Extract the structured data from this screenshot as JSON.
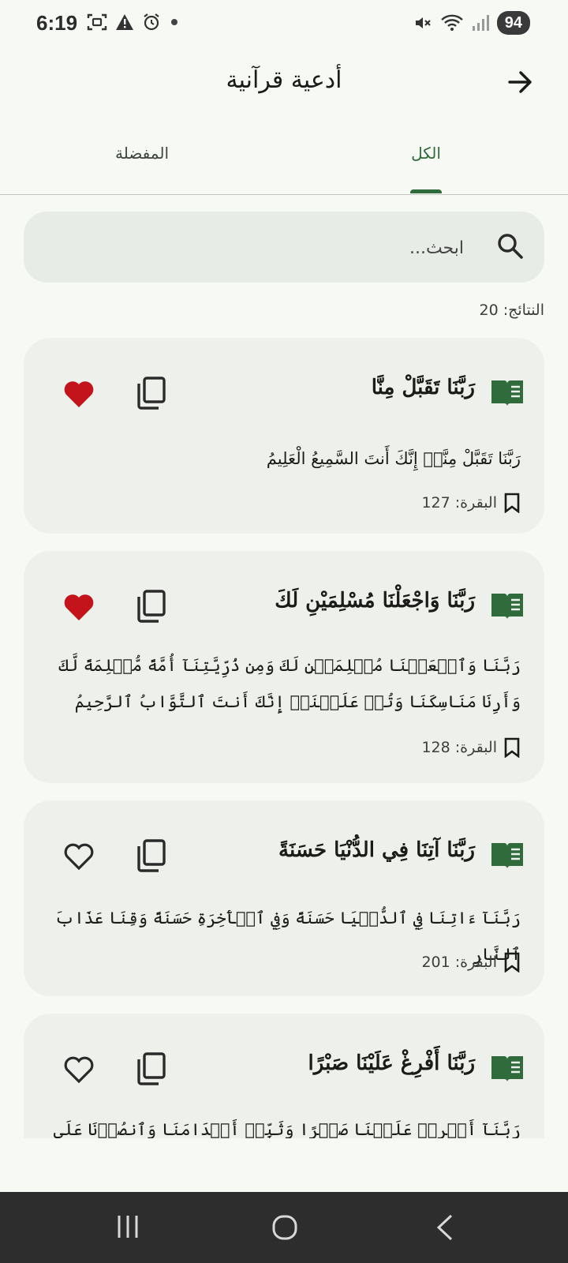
{
  "status_bar": {
    "time": "6:19",
    "battery": "94"
  },
  "app_bar": {
    "title": "أدعية قرآنية"
  },
  "tabs": [
    {
      "label": "الكل",
      "selected": true
    },
    {
      "label": "المفضلة",
      "selected": false
    }
  ],
  "search": {
    "placeholder": "ابحث..."
  },
  "results_label": "النتائج: 20",
  "cards": [
    {
      "title": "رَبَّنَا تَقَبَّلْ مِنَّا",
      "text": "رَبَّنَا تَقَبَّلْ مِنَّاۖ إِنَّكَ أَنتَ السَّمِيعُ الْعَلِيمُ",
      "reference": "البقرة: 127",
      "favorite": true
    },
    {
      "title": "رَبَّنَا وَاجْعَلْنَا مُسْلِمَيْنِ لَكَ",
      "text": "رَبَّنَا وَٱجۡعَلۡنَا مُسۡلِمَيۡنِ لَكَ وَمِن ذُرِّيَّتِنَآ أُمَّةً مُّسۡلِمَةً لَّكَ وَأَرِنَا مَنَاسِكَنَا وَتُبۡ عَلَيۡنَآۖ إِنَّكَ أَنتَ ٱلتَّوَّابُ ٱلرَّحِيمُ",
      "reference": "البقرة: 128",
      "favorite": true
    },
    {
      "title": "رَبَّنَا آتِنَا فِي الدُّنْيَا حَسَنَةً",
      "text": "رَبَّنَآ ءَاتِنَا فِي ٱلدُّنۡيَا حَسَنَةً وَفِي ٱلۡأٓخِرَةِ حَسَنَةً وَقِنَا عَذَابَ ٱلنَّارِ",
      "reference": "البقرة: 201",
      "favorite": false
    },
    {
      "title": "رَبَّنَا أَفْرِغْ عَلَيْنَا صَبْرًا",
      "text": "رَبَّنَآ أَفۡرِغۡ عَلَيۡنَا صَبۡرًا وَثَبِّتۡ أَقۡدَامَنَا وَٱنصُرۡنَا عَلَى ٱلۡقَوۡمِ ٱلۡكَٰفِرِينَ",
      "reference": "",
      "favorite": false
    }
  ],
  "colors": {
    "accent": "#2f6b3b",
    "heart": "#c4141b",
    "background": "#f6f9f4",
    "card": "#eef1eb"
  }
}
